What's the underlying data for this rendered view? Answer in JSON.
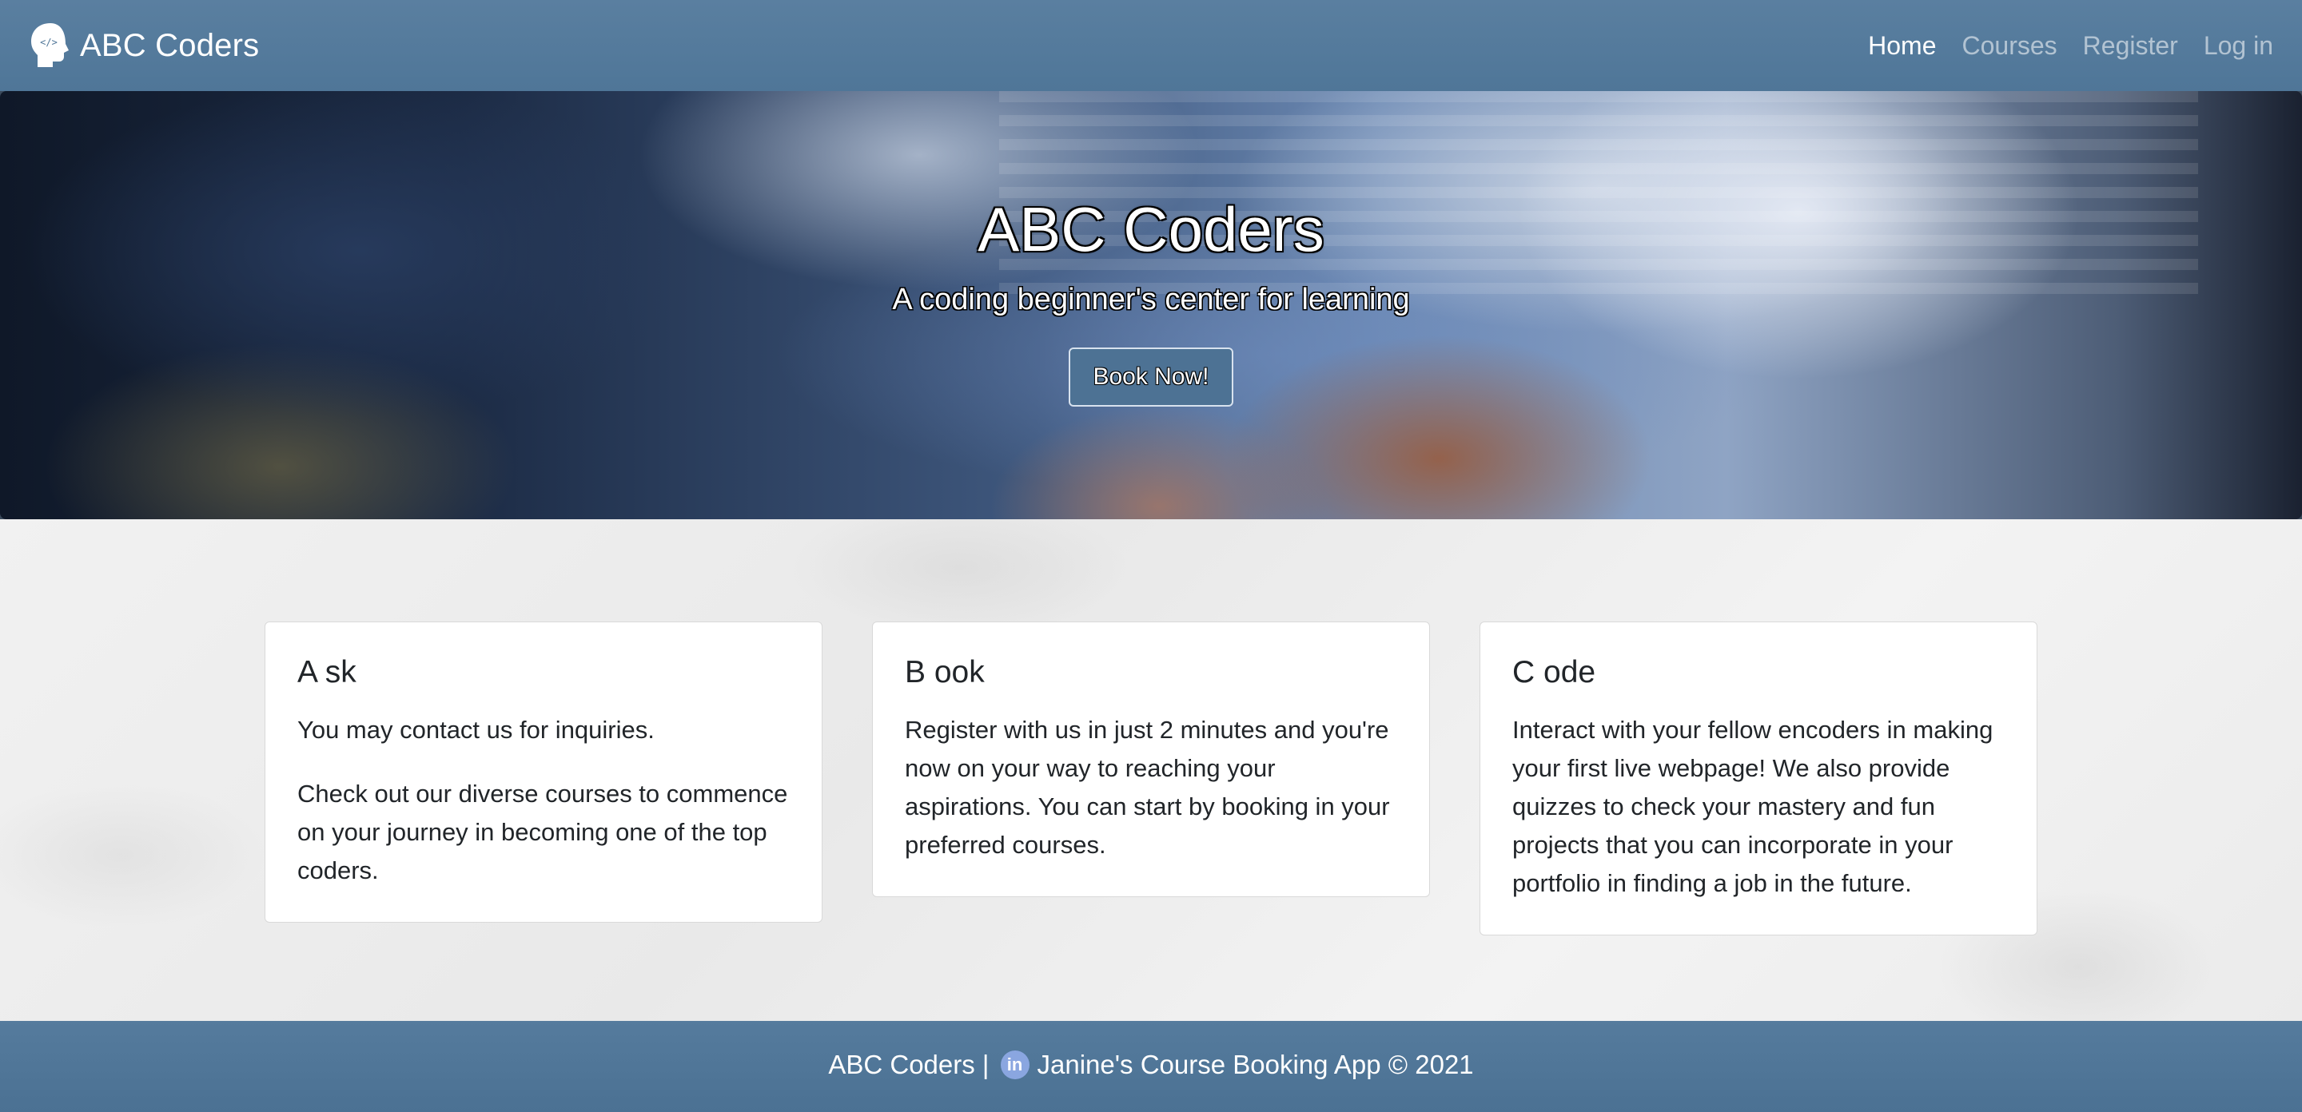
{
  "navbar": {
    "brand": "ABC Coders",
    "links": [
      {
        "label": "Home",
        "active": true
      },
      {
        "label": "Courses",
        "active": false
      },
      {
        "label": "Register",
        "active": false
      },
      {
        "label": "Log in",
        "active": false
      }
    ]
  },
  "hero": {
    "title": "ABC Coders",
    "subtitle": "A coding beginner's center for learning",
    "button_label": "Book Now!"
  },
  "cards": [
    {
      "title": "A sk",
      "paragraphs": [
        "You may contact us for inquiries.",
        "Check out our diverse courses to commence on your journey in becoming one of the top coders."
      ]
    },
    {
      "title": "B ook",
      "paragraphs": [
        "Register with us in just 2 minutes and you're now on your way to reaching your aspirations. You can start by booking in your preferred courses."
      ]
    },
    {
      "title": "C ode",
      "paragraphs": [
        "Interact with your fellow encoders in making your first live webpage! We also provide quizzes to check your mastery and fun projects that you can incorporate in your portfolio in finding a job in the future."
      ]
    }
  ],
  "footer": {
    "prefix": "ABC Coders |",
    "linkedin_icon_text": "in",
    "suffix": "Janine's Course Booking App © 2021"
  },
  "icons": {
    "brand_logo": "head-code-icon",
    "social": "linkedin-icon"
  },
  "colors": {
    "navbar_bg": "#5a7fa0",
    "footer_bg": "#557b9d",
    "button_bg": "#4d7294",
    "linkedin": "#8aa6e0"
  }
}
